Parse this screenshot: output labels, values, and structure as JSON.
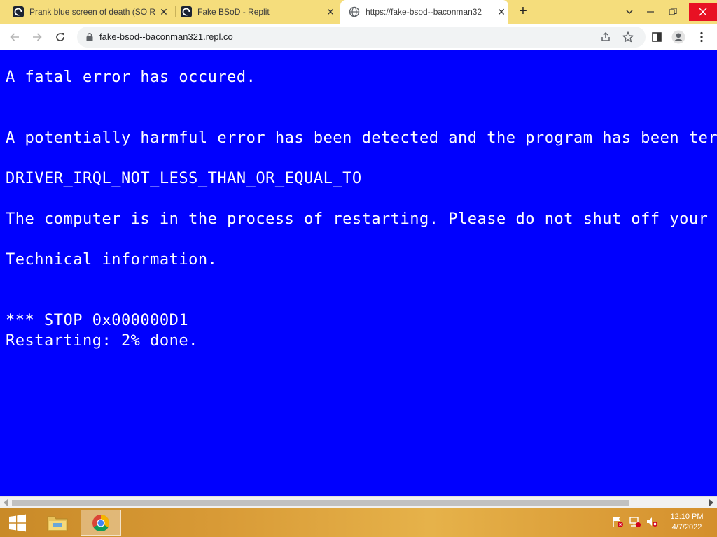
{
  "browser": {
    "tabs": [
      {
        "title": "Prank blue screen of death (SO R",
        "active": false,
        "icon": "replit-icon"
      },
      {
        "title": "Fake BSoD - Replit",
        "active": false,
        "icon": "replit-icon"
      },
      {
        "title": "https://fake-bsod--baconman32",
        "active": true,
        "icon": "globe-icon"
      }
    ],
    "new_tab_label": "+",
    "url": "fake-bsod--baconman321.repl.co"
  },
  "bsod": {
    "line1": "A fatal error has occured.",
    "line2": "A potentially harmful error has been detected and the program has been ter",
    "line3": "DRIVER_IRQL_NOT_LESS_THAN_OR_EQUAL_TO",
    "line4": "The computer is in the process of restarting. Please do not shut off your",
    "line5": "Technical information.",
    "line6": "*** STOP 0x000000D1",
    "line7": "Restarting: 2% done.",
    "background_color": "#0000fe",
    "text_color": "#ffffff"
  },
  "taskbar": {
    "time": "12:10 PM",
    "date": "4/7/2022"
  }
}
